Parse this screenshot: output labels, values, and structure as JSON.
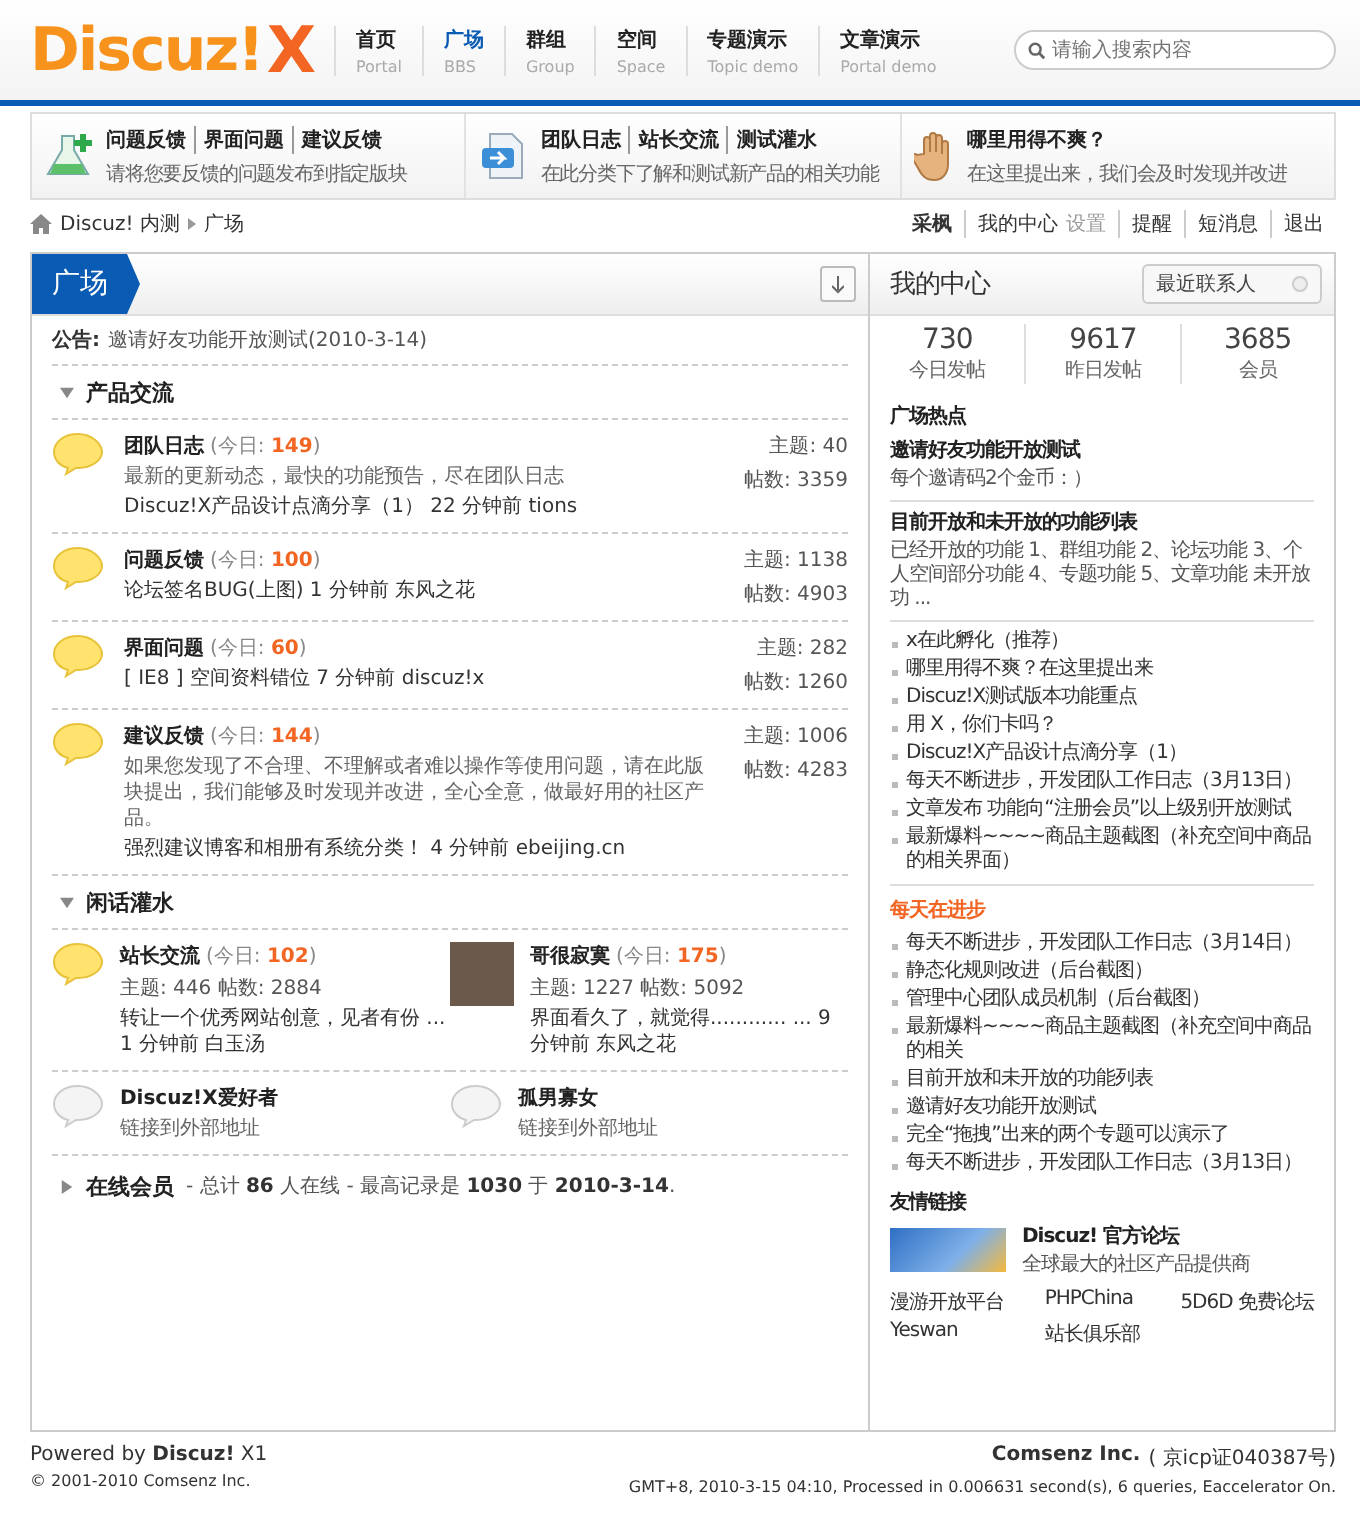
{
  "logo": {
    "text": "Discuz!",
    "mark": "X"
  },
  "nav": [
    {
      "label": "首页",
      "sub": "Portal",
      "selected": false
    },
    {
      "label": "广场",
      "sub": "BBS",
      "selected": true
    },
    {
      "label": "群组",
      "sub": "Group",
      "selected": false
    },
    {
      "label": "空间",
      "sub": "Space",
      "selected": false
    },
    {
      "label": "专题演示",
      "sub": "Topic demo",
      "selected": false
    },
    {
      "label": "文章演示",
      "sub": "Portal demo",
      "selected": false
    }
  ],
  "search": {
    "placeholder": "请输入搜索内容"
  },
  "promo": [
    {
      "kind": "flask",
      "links": [
        "问题反馈",
        "界面问题",
        "建议反馈"
      ],
      "desc": "请将您要反馈的问题发布到指定版块"
    },
    {
      "kind": "document",
      "links": [
        "团队日志",
        "站长交流",
        "测试灌水"
      ],
      "desc": "在此分类下了解和测试新产品的相关功能"
    },
    {
      "kind": "hand",
      "links": [
        "哪里用得不爽？"
      ],
      "desc": "在这里提出来，我们会及时发现并改进"
    }
  ],
  "breadcrumb": [
    "Discuz! 内测",
    "广场"
  ],
  "user_menu": [
    [
      "采枫"
    ],
    [
      "我的中心",
      "设置"
    ],
    [
      "提醒"
    ],
    [
      "短消息"
    ],
    [
      "退出"
    ]
  ],
  "main": {
    "title": "广场",
    "announcement": {
      "label": "公告:",
      "text": "邀请好友功能开放测试(2010-3-14)"
    },
    "categories": [
      {
        "name": "产品交流",
        "expanded": true,
        "kind": "list",
        "forums": [
          {
            "kind": "new",
            "name": "团队日志",
            "today": "(今日: **149**)",
            "desc": "最新的更新动态，最快的功能预告，尽在团队日志",
            "last_post": "Discuz!X产品设计点滴分享（1） 22 分钟前 tions",
            "topics": "主题: 40",
            "posts": "帖数: 3359"
          },
          {
            "kind": "new",
            "name": "问题反馈",
            "today": "(今日: **100**)",
            "last_post": "论坛签名BUG(上图) 1 分钟前 东风之花",
            "topics": "主题: 1138",
            "posts": "帖数: 4903"
          },
          {
            "kind": "new",
            "name": "界面问题",
            "today": "(今日: **60**)",
            "last_post": "[ IE8 ] 空间资料错位 7 分钟前 discuz!x",
            "topics": "主题: 282",
            "posts": "帖数: 1260"
          },
          {
            "kind": "new",
            "name": "建议反馈",
            "today": "(今日: **144**)",
            "desc": "如果您发现了不合理、不理解或者难以操作等使用问题，请在此版块提出，我们能够及时发现并改进，全心全意，做最好用的社区产品。",
            "last_post": "强烈建议博客和相册有系统分类！ 4 分钟前 ebeijing.cn",
            "topics": "主题: 1006",
            "posts": "帖数: 4283"
          }
        ]
      },
      {
        "name": "闲话灌水",
        "expanded": true,
        "kind": "grid",
        "forums": [
          {
            "kind": "new",
            "name": "站长交流",
            "today": "(今日: **102**)",
            "stats": "主题: 446 帖数: 2884",
            "last_post": "转让一个优秀网站创意，见者有份 ... 1 分钟前 白玉汤"
          },
          {
            "kind": "photo",
            "name": "哥很寂寞",
            "today": "(今日: **175**)",
            "stats": "主题: 1227 帖数: 5092",
            "last_post": "界面看久了，就觉得............ ... 9 分钟前 东风之花"
          },
          {
            "kind": "link",
            "name": "Discuz!X爱好者",
            "desc": "链接到外部地址"
          },
          {
            "kind": "link",
            "name": "孤男寡女",
            "desc": "链接到外部地址"
          }
        ]
      }
    ],
    "online": {
      "expanded": false,
      "title": "在线会员",
      "text": " - 总计 **86** 人在线 - 最高记录是 **1030** 于 **2010-3-14**."
    }
  },
  "side": {
    "title": "我的中心",
    "select": "最近联系人",
    "stats": [
      {
        "value": "730",
        "label": "今日发帖"
      },
      {
        "value": "9617",
        "label": "昨日发帖"
      },
      {
        "value": "3685",
        "label": "会员"
      }
    ],
    "hot": {
      "title": "广场热点",
      "featured": [
        {
          "title": "邀请好友功能开放测试",
          "summary": "每个邀请码2个金币：）"
        },
        {
          "title": "目前开放和未开放的功能列表",
          "summary": "已经开放的功能 1、群组功能 2、论坛功能 3、个人空间部分功能 4、专题功能 5、文章功能 未开放功 ..."
        }
      ],
      "items": [
        "x在此孵化（推荐）",
        "哪里用得不爽？在这里提出来",
        "Discuz!X测试版本功能重点",
        "用 X，你们卡吗？",
        "Discuz!X产品设计点滴分享（1）",
        "每天不断进步，开发团队工作日志（3月13日）",
        "文章发布 功能向“注册会员”以上级别开放测试",
        "最新爆料~~~~商品主题截图（补充空间中商品的相关界面）"
      ]
    },
    "progress": {
      "title": "每天在进步",
      "items": [
        "每天不断进步，开发团队工作日志（3月14日）",
        "静态化规则改进（后台截图）",
        "管理中心团队成员机制（后台截图）",
        "最新爆料~~~~商品主题截图（补充空间中商品的相关",
        "目前开放和未开放的功能列表",
        "邀请好友功能开放测试",
        "完全“拖拽”出来的两个专题可以演示了",
        "每天不断进步，开发团队工作日志（3月13日）"
      ]
    },
    "links": {
      "title": "友情链接",
      "featured": {
        "title": "Discuz! 官方论坛",
        "desc": "全球最大的社区产品提供商"
      },
      "items": [
        "漫游开放平台",
        "PHPChina",
        "5D6D 免费论坛",
        "Yeswan",
        "站长俱乐部"
      ]
    }
  },
  "footer": {
    "powered": "Powered by **Discuz!** X1",
    "copyright": "© 2001-2010 Comsenz Inc.",
    "company": "Comsenz Inc.",
    "icp": "( 京icp证040387号)",
    "stats": "GMT+8, 2010-3-15 04:10, Processed in 0.006631 second(s), 6 queries, Eaccelerator On."
  }
}
